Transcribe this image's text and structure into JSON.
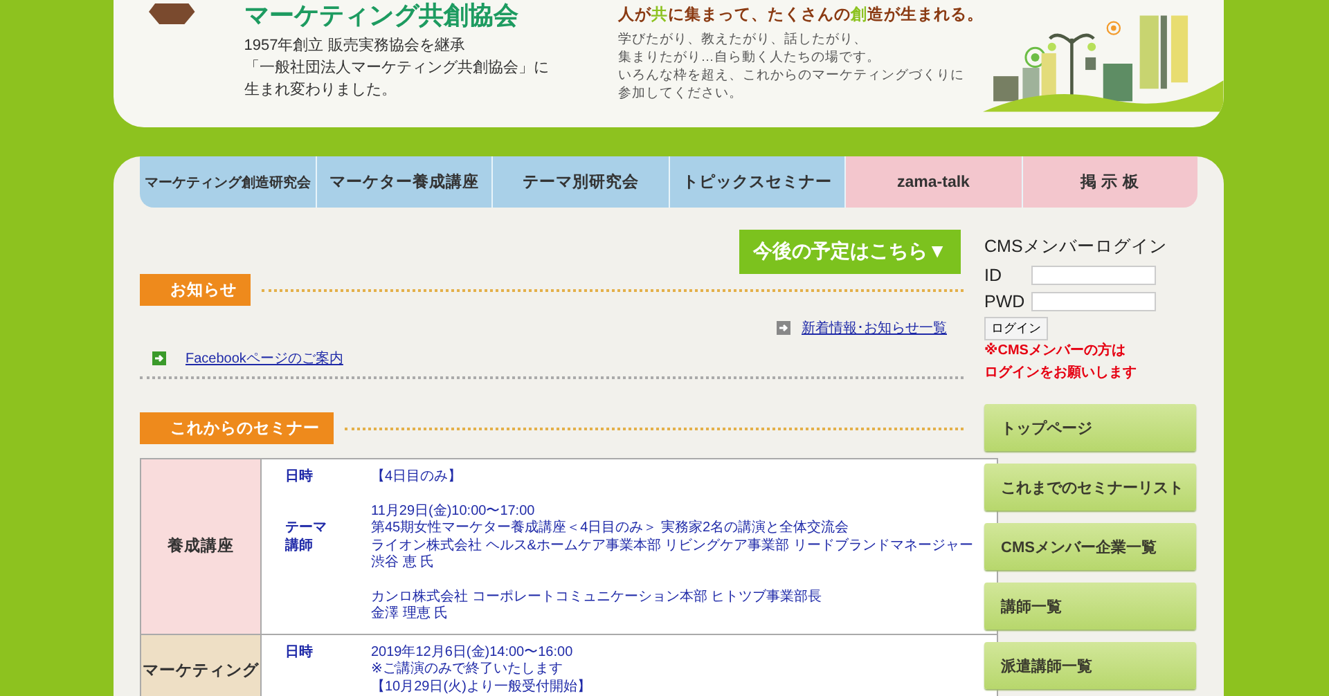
{
  "header": {
    "title": "マーケティング共創協会",
    "history_lines": [
      "1957年創立 販売実務協会を継承",
      "「一般社団法人マーケティング共創協会」に",
      "生まれ変わりました。"
    ],
    "tagline": "人が**共**に集まって、たくさんの**創**造が生まれる。",
    "description_lines": [
      "学びたがり、教えたがり、話したがり、",
      "集まりたがり…自ら動く人たちの場です。",
      "いろんな枠を超え、これからのマーケティングづくりに",
      "参加してください。"
    ]
  },
  "nav": [
    {
      "label": "マーケティング創造研究会",
      "color": "#a9d0e8"
    },
    {
      "label": "マーケター養成講座",
      "color": "#a9d0e8"
    },
    {
      "label": "テーマ別研究会",
      "color": "#a9d0e8"
    },
    {
      "label": "トピックスセミナー",
      "color": "#a9d0e8"
    },
    {
      "label": "zama-talk",
      "color": "#f3c6cd"
    },
    {
      "label": "掲 示 板",
      "color": "#f3c6cd"
    }
  ],
  "schedule_button": "今後の予定はこちら▼",
  "notices": {
    "heading": "お知らせ",
    "more_link": "新着情報･お知らせ一覧",
    "items": [
      "Facebookページのご案内"
    ]
  },
  "seminars": {
    "heading": "これからのセミナー",
    "rows": [
      {
        "category": "養成講座",
        "color": "#f9dcdc",
        "fields": [
          {
            "label": "日時",
            "paragraphs": [
              [
                "【4日目のみ】"
              ],
              [
                "11月29日(金)10:00〜17:00"
              ]
            ]
          },
          {
            "label": "テーマ",
            "paragraphs": [
              [
                "第45期女性マーケター養成講座＜4日目のみ＞ 実務家2名の講演と全体交流会"
              ]
            ]
          },
          {
            "label": "講師",
            "paragraphs": [
              [
                "ライオン株式会社 ヘルス&ホームケア事業本部 リビングケア事業部 リードブランドマネージャー",
                "渋谷 恵 氏"
              ],
              [
                "カンロ株式会社 コーポレートコミュニケーション本部 ヒトツブ事業部長",
                "金澤 理恵 氏"
              ]
            ]
          }
        ]
      },
      {
        "category": "マーケティング",
        "color": "#eedfc5",
        "fields": [
          {
            "label": "日時",
            "paragraphs": [
              [
                "2019年12月6日(金)14:00〜16:00",
                "※ご講演のみで終了いたします",
                "【10月29日(火)より一般受付開始】"
              ]
            ]
          }
        ]
      }
    ]
  },
  "login": {
    "title": "CMSメンバーログイン",
    "id_label": "ID",
    "pwd_label": "PWD",
    "button": "ログイン",
    "note_lines": [
      "※CMSメンバーの方は",
      "ログインをお願いします"
    ]
  },
  "side_menu": [
    "トップページ",
    "これまでのセミナーリスト",
    "CMSメンバー企業一覧",
    "講師一覧",
    "派遣講師一覧"
  ]
}
